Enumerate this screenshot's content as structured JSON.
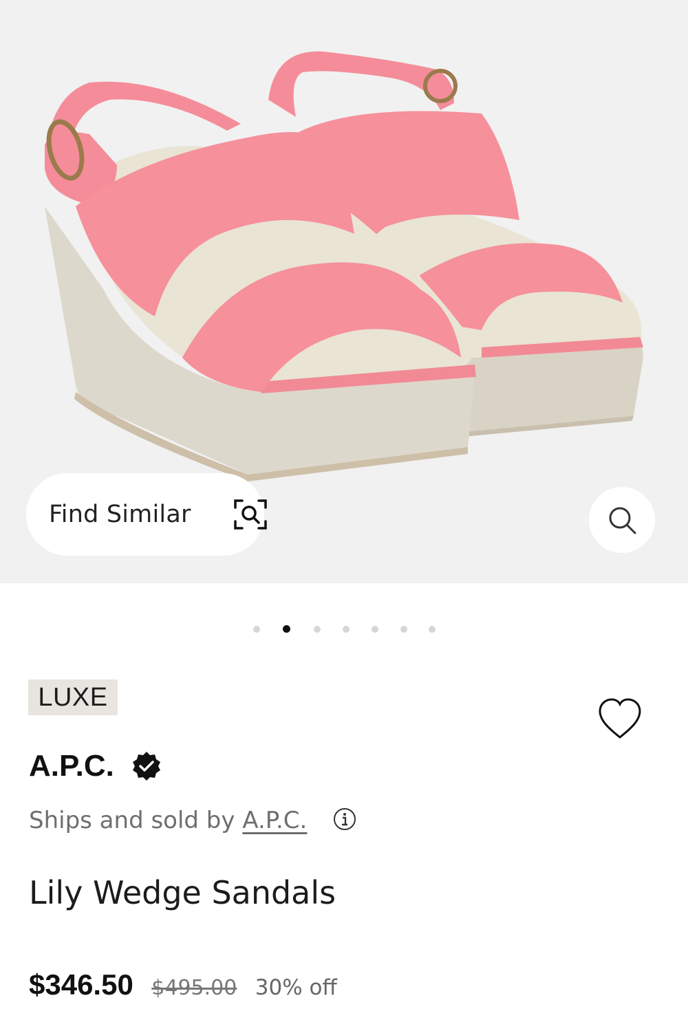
{
  "product_image": {
    "find_similar_label": "Find Similar",
    "icons": {
      "find_similar": "scan-search-icon",
      "zoom": "search-icon"
    },
    "carousel": {
      "total": 7,
      "active_index": 1
    }
  },
  "product": {
    "badge": "LUXE",
    "brand": "A.P.C.",
    "seller_prefix": "Ships and sold by",
    "seller_name": "A.P.C.",
    "name": "Lily Wedge Sandals",
    "price_current": "$346.50",
    "price_original": "$495.00",
    "discount": "30% off",
    "icons": {
      "wishlist": "heart-icon",
      "verified": "verified-badge-icon",
      "info": "info-icon"
    }
  },
  "colors": {
    "hero_background": "#f1f1f1",
    "sandal_pink": "#f28a95",
    "wedge_cream": "#ddd8cc",
    "badge_background": "#e8e5e0"
  }
}
